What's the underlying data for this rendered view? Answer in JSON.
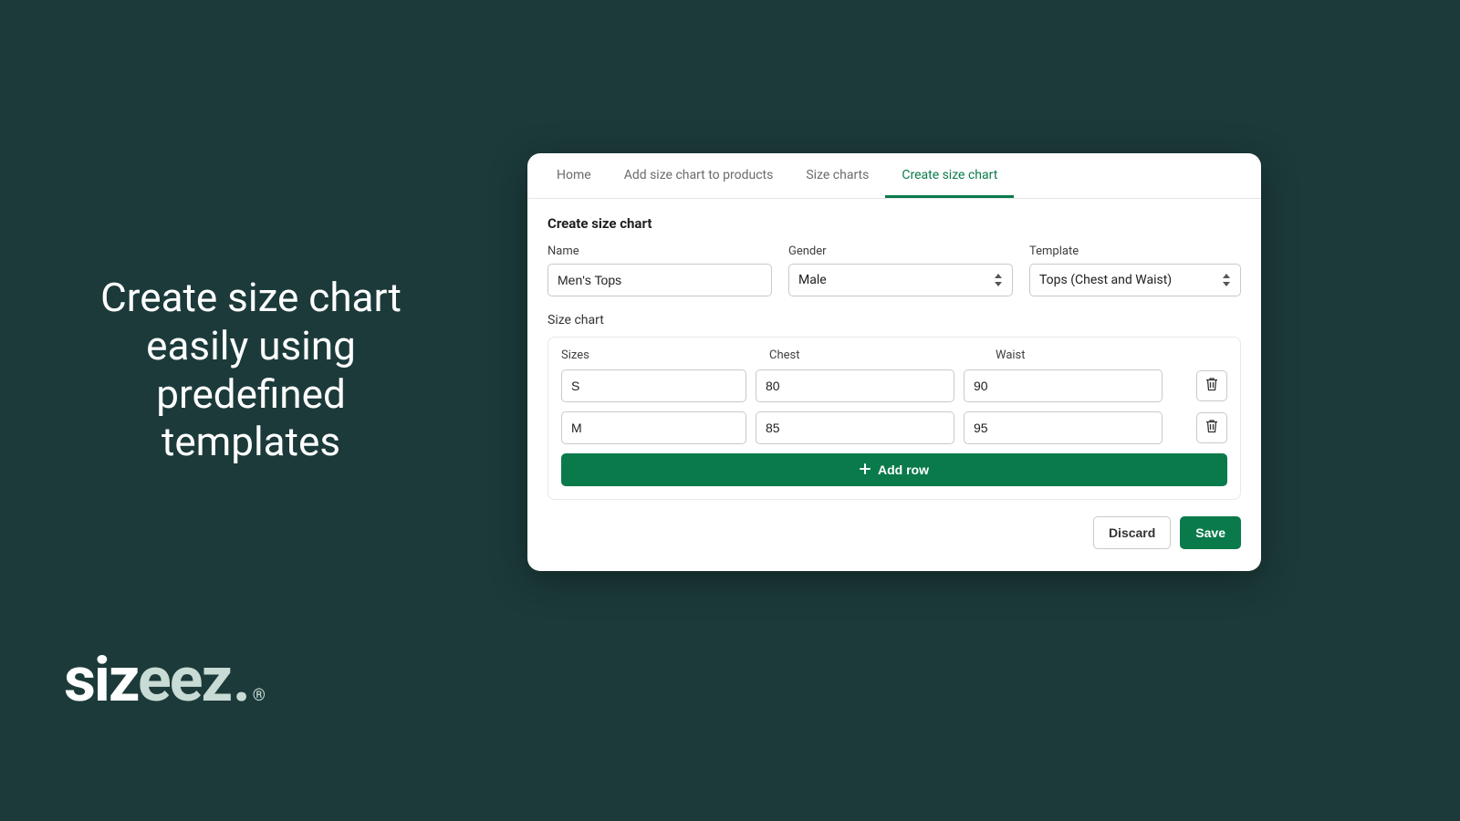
{
  "hero": {
    "line1": "Create size chart",
    "line2": "easily using",
    "line3": "predefined",
    "line4": "templates"
  },
  "logo": {
    "prefix": "siz",
    "suffix": "eez",
    "period": ".",
    "reg": "®"
  },
  "tabs": [
    {
      "label": "Home",
      "active": false
    },
    {
      "label": "Add size chart to products",
      "active": false
    },
    {
      "label": "Size charts",
      "active": false
    },
    {
      "label": "Create size chart",
      "active": true
    }
  ],
  "section_title": "Create size chart",
  "fields": {
    "name": {
      "label": "Name",
      "value": "Men's Tops"
    },
    "gender": {
      "label": "Gender",
      "value": "Male"
    },
    "template": {
      "label": "Template",
      "value": "Tops (Chest and Waist)"
    }
  },
  "grid": {
    "title": "Size chart",
    "headers": {
      "sizes": "Sizes",
      "chest": "Chest",
      "waist": "Waist"
    },
    "rows": [
      {
        "size": "S",
        "chest": "80",
        "waist": "90"
      },
      {
        "size": "M",
        "chest": "85",
        "waist": "95"
      }
    ],
    "add_row_label": "Add row"
  },
  "buttons": {
    "discard": "Discard",
    "save": "Save"
  }
}
